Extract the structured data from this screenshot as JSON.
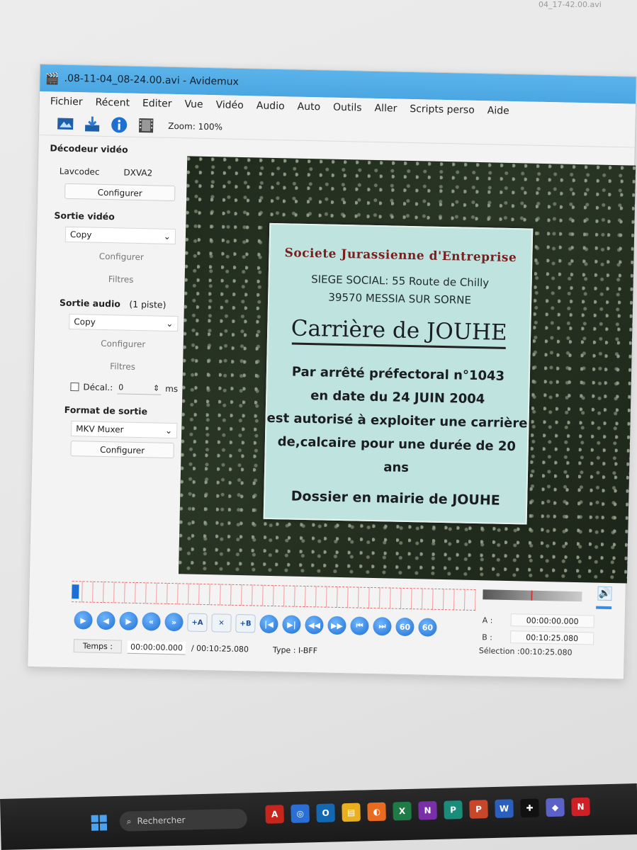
{
  "window": {
    "title": ".08-11-04_08-24.00.avi - Avidemux"
  },
  "menu": [
    "Fichier",
    "Récent",
    "Editer",
    "Vue",
    "Vidéo",
    "Audio",
    "Auto",
    "Outils",
    "Aller",
    "Scripts perso",
    "Aide"
  ],
  "toolbar": {
    "icons": [
      "open-video-icon",
      "save-video-icon",
      "info-icon",
      "film-icon"
    ],
    "zoom_label": "Zoom: 100%"
  },
  "left_panel": {
    "video_decoder": {
      "title": "Décodeur vidéo",
      "decoder": "Lavcodec",
      "accel": "DXVA2",
      "configure": "Configurer"
    },
    "video_output": {
      "title": "Sortie vidéo",
      "selected": "Copy",
      "configure": "Configurer",
      "filters": "Filtres"
    },
    "audio_output": {
      "title": "Sortie audio",
      "tracks": "(1 piste)",
      "selected": "Copy",
      "configure": "Configurer",
      "filters": "Filtres",
      "offset_label": "Décal.:",
      "offset_value": "0",
      "offset_unit": "ms"
    },
    "output_format": {
      "title": "Format de sortie",
      "selected": "MKV Muxer",
      "configure": "Configurer"
    }
  },
  "video_frame": {
    "sign": {
      "company": "Societe Jurassienne d'Entreprise",
      "address_line1": "SIEGE SOCIAL: 55 Route de Chilly",
      "address_line2": "39570 MESSIA SUR SORNE",
      "title": "Carrière de JOUHE",
      "body_line1": "Par arrêté préfectoral n°1043",
      "body_line2": "en date du 24 JUIN 2004",
      "body_line3": "est autorisé à exploiter une carrière",
      "body_line4": "de,calcaire pour une durée de 20 ans",
      "footer": "Dossier en mairie de JOUHE"
    }
  },
  "markers": {
    "a_label": "A :",
    "a_value": "00:00:00.000",
    "b_label": "B :",
    "b_value": "00:10:25.080",
    "selection": "Sélection :00:10:25.080"
  },
  "controls": [
    "▶",
    "◀",
    "▶",
    "«",
    "»",
    "+A",
    "✕",
    "+B",
    "|◀",
    "▶|",
    "◀◀",
    "▶▶",
    "⏮",
    "⏭",
    "60",
    "60"
  ],
  "status": {
    "time_label": "Temps :",
    "current_time": "00:00:00.000",
    "total_time": "/ 00:10:25.080",
    "type": "Type : I-BFF"
  },
  "taskbar": {
    "search_placeholder": "Rechercher",
    "apps": [
      {
        "label": "A",
        "color": "#c8261c"
      },
      {
        "label": "◎",
        "color": "#2b6fd6"
      },
      {
        "label": "O",
        "color": "#1268b3"
      },
      {
        "label": "▤",
        "color": "#e8b021"
      },
      {
        "label": "◐",
        "color": "#e86b1f"
      },
      {
        "label": "X",
        "color": "#1e7b45"
      },
      {
        "label": "N",
        "color": "#7a2fa8"
      },
      {
        "label": "P",
        "color": "#1a8c7a"
      },
      {
        "label": "P",
        "color": "#c9462a"
      },
      {
        "label": "W",
        "color": "#2b5fbd"
      },
      {
        "label": "✚",
        "color": "#111111"
      },
      {
        "label": "◆",
        "color": "#5a62c7"
      },
      {
        "label": "N",
        "color": "#d11f26"
      }
    ]
  }
}
